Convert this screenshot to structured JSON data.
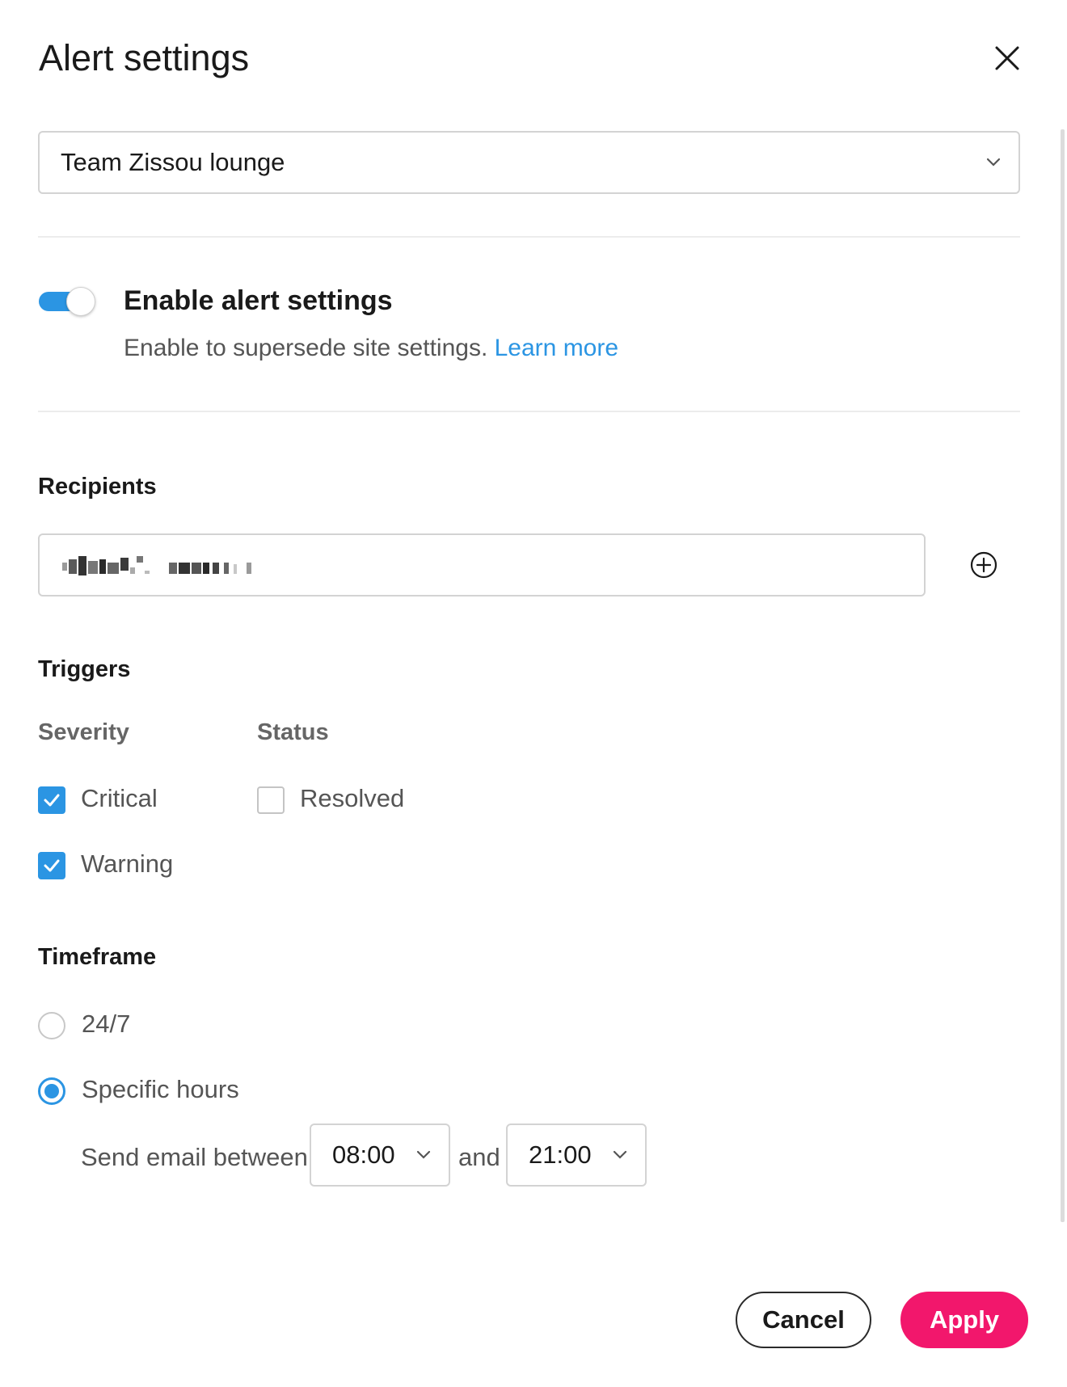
{
  "dialog": {
    "title": "Alert settings"
  },
  "site_select": {
    "value": "Team Zissou lounge"
  },
  "enable": {
    "enabled": true,
    "title": "Enable alert settings",
    "description": "Enable to supersede site settings.",
    "link": "Learn more"
  },
  "recipients": {
    "heading": "Recipients"
  },
  "triggers": {
    "heading": "Triggers",
    "severity": {
      "heading": "Severity",
      "options": [
        {
          "label": "Critical",
          "checked": true
        },
        {
          "label": "Warning",
          "checked": true
        }
      ]
    },
    "status": {
      "heading": "Status",
      "options": [
        {
          "label": "Resolved",
          "checked": false
        }
      ]
    }
  },
  "timeframe": {
    "heading": "Timeframe",
    "options": [
      {
        "label": "24/7",
        "selected": false
      },
      {
        "label": "Specific hours",
        "selected": true
      }
    ],
    "between_label": "Send email between",
    "and_label": "and",
    "start": "08:00",
    "end": "21:00"
  },
  "footer": {
    "cancel": "Cancel",
    "apply": "Apply"
  },
  "colors": {
    "accent": "#2b95e3",
    "primary_button": "#f2176c"
  }
}
